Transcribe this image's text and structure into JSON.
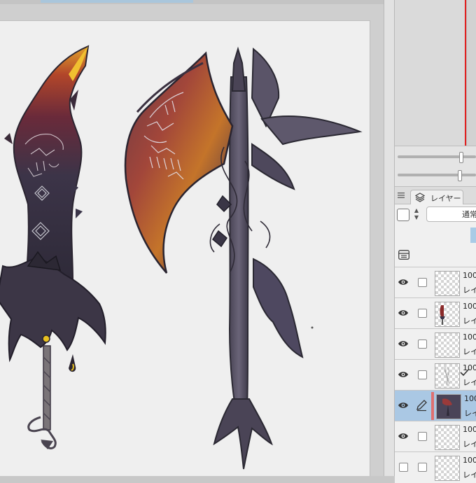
{
  "layer_panel": {
    "tab_label": "レイヤー",
    "blend_mode": "通常",
    "layers": [
      {
        "opacity": "100",
        "name": "レイ",
        "visible": true,
        "state": "checkbox",
        "thumb": "empty"
      },
      {
        "opacity": "100",
        "name": "レイ",
        "visible": true,
        "state": "checkbox",
        "thumb": "sword"
      },
      {
        "opacity": "100",
        "name": "レイ",
        "visible": true,
        "state": "checkbox",
        "thumb": "empty"
      },
      {
        "opacity": "100",
        "name": "レイ",
        "visible": true,
        "state": "check-mark",
        "thumb": "sketch"
      },
      {
        "opacity": "100",
        "name": "レイ",
        "visible": true,
        "state": "pen",
        "thumb": "dark",
        "selected": true
      },
      {
        "opacity": "100",
        "name": "レイ",
        "visible": true,
        "state": "checkbox",
        "thumb": "empty"
      },
      {
        "opacity": "100",
        "name": "レイ",
        "visible": false,
        "state": "checkbox",
        "thumb": "empty"
      }
    ]
  },
  "colors": {
    "canvas_bg": "#efefef",
    "selection": "#aac8e4",
    "navigator_line": "#e02020",
    "weapon_dark": "#3e3a48",
    "blade_red": "#8a2a2a",
    "blade_orange": "#d27a2a",
    "gem_yellow": "#e8c020"
  }
}
